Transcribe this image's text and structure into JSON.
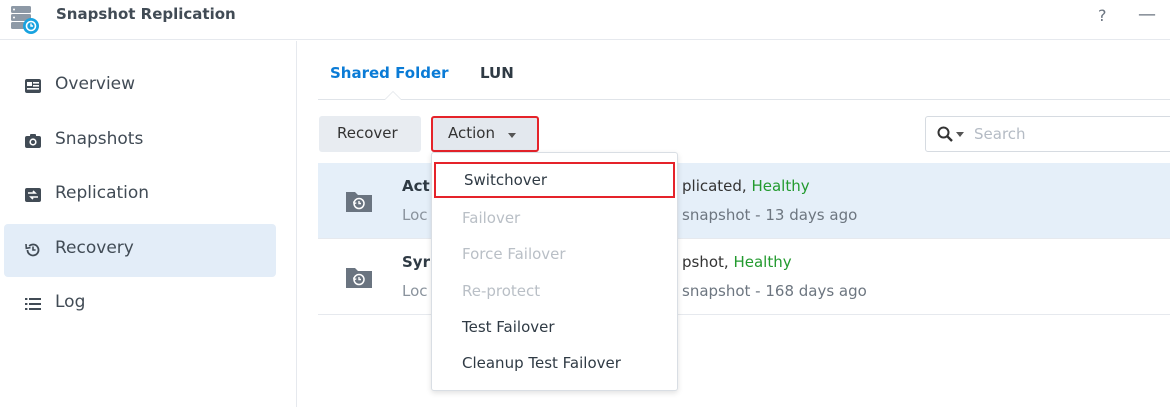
{
  "app": {
    "title": "Snapshot Replication",
    "help_label": "?",
    "minimize_label": "—"
  },
  "sidebar": {
    "items": [
      {
        "label": "Overview",
        "icon": "overview-icon"
      },
      {
        "label": "Snapshots",
        "icon": "camera-icon"
      },
      {
        "label": "Replication",
        "icon": "replication-icon"
      },
      {
        "label": "Recovery",
        "icon": "recovery-icon",
        "active": true
      },
      {
        "label": "Log",
        "icon": "list-icon"
      }
    ]
  },
  "tabs": [
    {
      "label": "Shared Folder",
      "active": true
    },
    {
      "label": "LUN"
    }
  ],
  "toolbar": {
    "recover_label": "Recover",
    "action_label": "Action"
  },
  "search": {
    "placeholder": "Search",
    "value": ""
  },
  "rows": [
    {
      "name": "Act",
      "status_prefix": "plicated, ",
      "status_health": "Healthy",
      "location": "Loc",
      "time": "snapshot - 13 days ago",
      "selected": true
    },
    {
      "name": "Syr",
      "status_prefix": "pshot, ",
      "status_health": "Healthy",
      "location": "Loc",
      "time": "snapshot - 168 days ago"
    }
  ],
  "action_menu": {
    "items": [
      {
        "label": "Switchover",
        "enabled": true,
        "highlighted": true
      },
      {
        "label": "Failover",
        "enabled": false
      },
      {
        "label": "Force Failover",
        "enabled": false
      },
      {
        "label": "Re-protect",
        "enabled": false
      },
      {
        "label": "Test Failover",
        "enabled": true
      },
      {
        "label": "Cleanup Test Failover",
        "enabled": true
      }
    ]
  },
  "colors": {
    "accent": "#0a7bd6",
    "healthy": "#229a2e",
    "highlight_border": "#e5232a",
    "selected_row": "#e5eff9"
  }
}
